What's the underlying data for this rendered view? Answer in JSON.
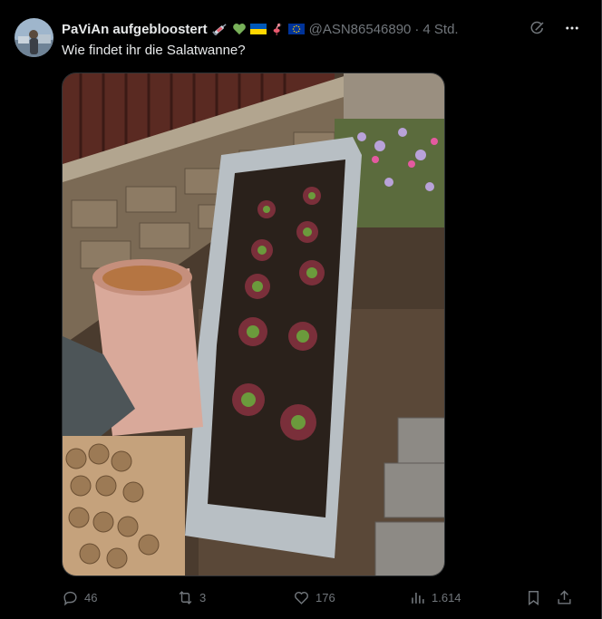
{
  "tweet": {
    "display_name": "PaViAn aufgebloostert",
    "emojis": [
      "syringe-icon",
      "green-heart-icon",
      "ukraine-flag-icon",
      "flamingo-icon",
      "eu-flag-icon"
    ],
    "handle": "@ASN86546890",
    "separator": "·",
    "time": "4 Std.",
    "text": "Wie findet ihr die Salatwanne?"
  },
  "metrics": {
    "replies": "46",
    "reposts": "3",
    "likes": "176",
    "views": "1.614"
  },
  "colors": {
    "background": "#000000",
    "primary_text": "#e7e9ea",
    "secondary_text": "#71767b",
    "border": "#2f3336"
  },
  "icons": {
    "top_right": [
      "grok-icon",
      "more-icon"
    ],
    "actions": [
      "reply-icon",
      "repost-icon",
      "like-icon",
      "views-icon",
      "bookmark-icon",
      "share-icon"
    ]
  }
}
